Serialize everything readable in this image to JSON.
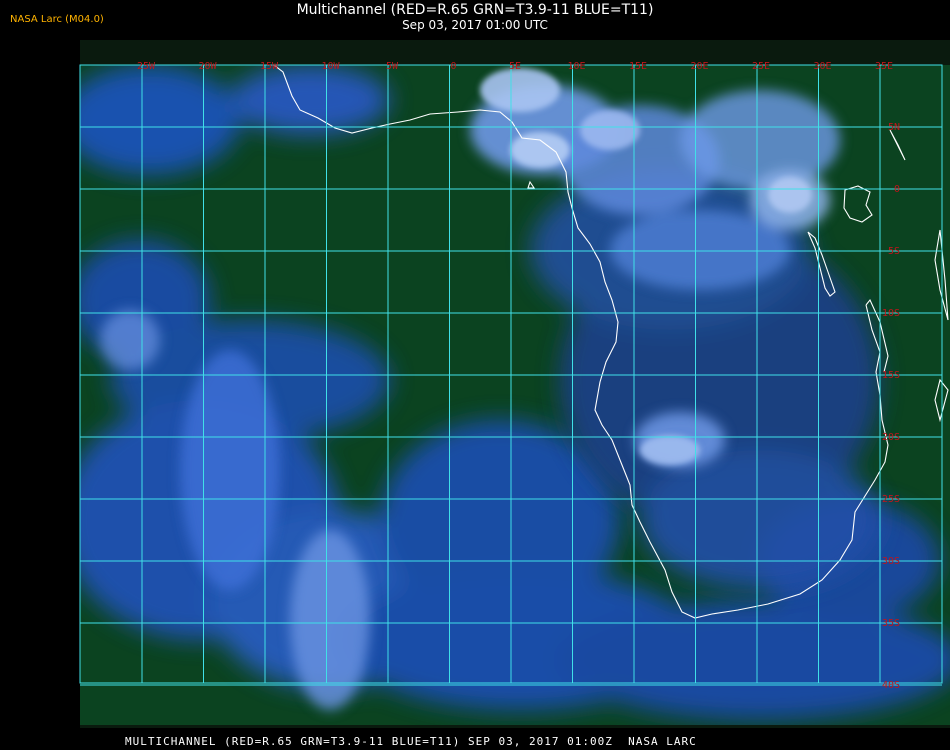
{
  "header": {
    "badge": "NASA Larc (M04.0)",
    "title": "Multichannel (RED=R.65 GRN=T3.9-11 BLUE=T11)",
    "subtitle": "Sep 03, 2017 01:00 UTC"
  },
  "footer": {
    "caption": "MULTICHANNEL (RED=R.65 GRN=T3.9-11 BLUE=T11) SEP 03, 2017 01:00Z  NASA LARC"
  },
  "map": {
    "longitude_labels": [
      "25W",
      "20W",
      "15W",
      "10W",
      "5W",
      "0",
      "5E",
      "10E",
      "15E",
      "20E",
      "25E",
      "30E",
      "35E"
    ],
    "latitude_labels": [
      "5N",
      "0",
      "5S",
      "10S",
      "15S",
      "20S",
      "25S",
      "30S",
      "35S",
      "40S"
    ],
    "colors": {
      "ocean": "#0a4a22",
      "clouds": "#2a5ad8",
      "bright_clouds": "#8fb4ec",
      "grid": "#40e0e8",
      "coast": "#ffffff",
      "label": "#c0161b"
    }
  }
}
